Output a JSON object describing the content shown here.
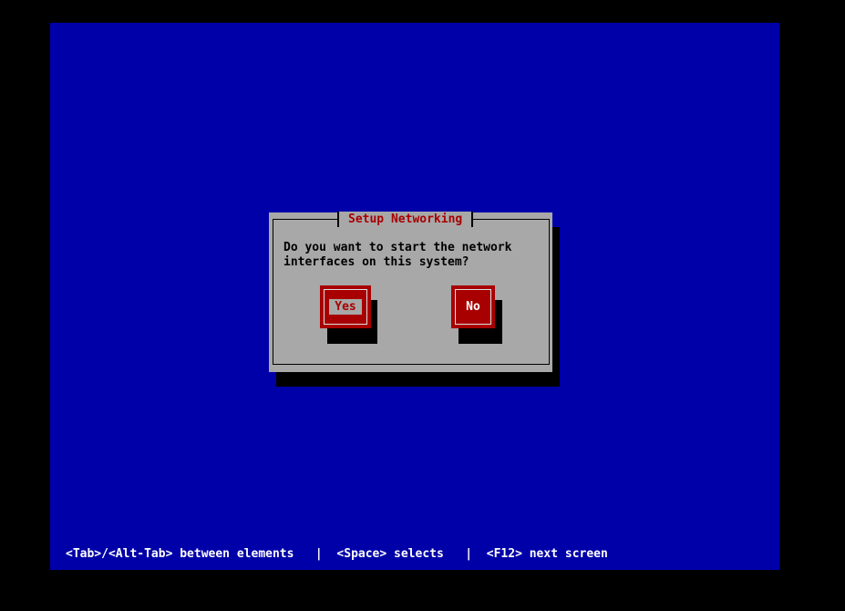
{
  "dialog": {
    "title": "Setup Networking",
    "message_line1": "Do you want to start the network",
    "message_line2": "interfaces on this system?",
    "buttons": {
      "yes_label": "Yes",
      "no_label": "No"
    }
  },
  "hint_bar": {
    "text": "<Tab>/<Alt-Tab> between elements   |  <Space> selects   |  <F12> next screen"
  },
  "colors": {
    "screen_background": "#0000a8",
    "dialog_background": "#a8a8a8",
    "title_color": "#a80000",
    "button_color": "#a80000"
  }
}
